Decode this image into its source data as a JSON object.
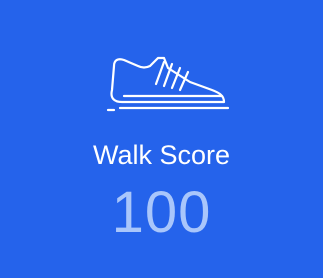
{
  "card": {
    "icon": "shoe-icon",
    "label": "Walk Score",
    "value": "100",
    "background_color": "#2563eb",
    "value_color": "#a9c6fb"
  }
}
